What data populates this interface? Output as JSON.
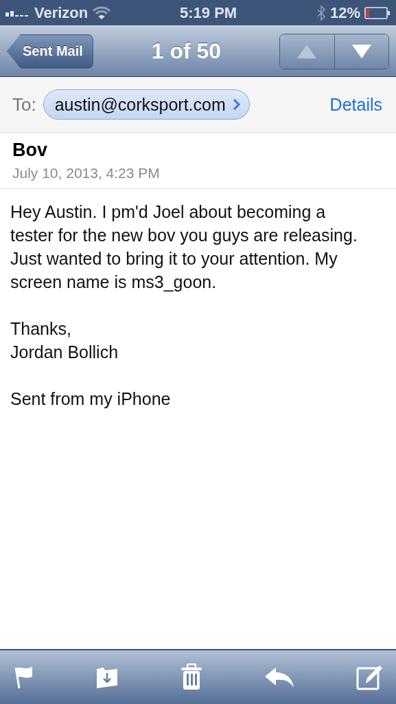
{
  "status_bar": {
    "carrier": "Verizon",
    "time": "5:19 PM",
    "battery_text": "12%"
  },
  "nav_bar": {
    "back": "Sent Mail",
    "title": "1 of 50",
    "arrows": [
      {
        "kind": "up",
        "disabled": true
      },
      {
        "kind": "down",
        "disabled": false
      }
    ]
  },
  "header": {
    "to_label": "To:",
    "recipient": "austin@corksport.com",
    "details": "Details",
    "subject": "Bov",
    "date": "July 10, 2013, 4:23 PM"
  },
  "body": [
    [
      "Hey Austin. I pm'd Joel about becoming a tester for the new bov you guys are releasing. Just wanted to bring it to your attention. My screen name is ms3_goon."
    ],
    [
      "Thanks,",
      "Jordan Bollich"
    ],
    [
      "Sent from my iPhone"
    ]
  ]
}
